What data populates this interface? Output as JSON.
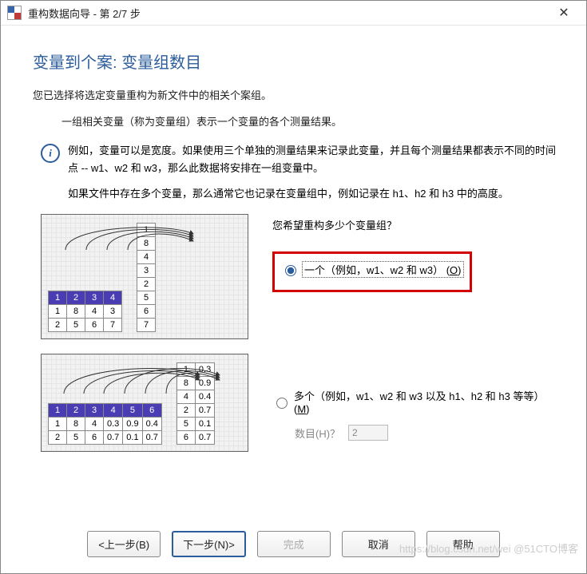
{
  "window": {
    "title": "重构数据向导 - 第 2/7 步"
  },
  "page_title": "变量到个案: 变量组数目",
  "intro": "您已选择将选定变量重构为新文件中的相关个案组。",
  "sub1": "一组相关变量（称为变量组）表示一个变量的各个测量结果。",
  "info1": "例如，变量可以是宽度。如果使用三个单独的测量结果来记录此变量，并且每个测量结果都表示不同的时间点 -- w1、w2 和 w3，那么此数据将安排在一组变量中。",
  "info2": "如果文件中存在多个变量，那么通常它也记录在变量组中，例如记录在 h1、h2 和 h3 中的高度。",
  "question": "您希望重构多少个变量组？",
  "options": {
    "one": {
      "label": "一个（例如，w1、w2 和 w3）",
      "shortcut": "O"
    },
    "many": {
      "label": "多个（例如，w1、w2 和 w3 以及 h1、h2 和 h3 等等）",
      "shortcut": "M"
    },
    "count_label": "数目(H)？",
    "count_value": "2"
  },
  "illustration1": {
    "source_headers": [
      "1",
      "2",
      "3",
      "4"
    ],
    "source_rows": [
      [
        "1",
        "8",
        "4",
        "3"
      ],
      [
        "2",
        "5",
        "6",
        "7"
      ]
    ],
    "target_col": [
      "1",
      "8",
      "4",
      "3",
      "2",
      "5",
      "6",
      "7"
    ]
  },
  "illustration2": {
    "source_headers": [
      "1",
      "2",
      "3",
      "4",
      "5",
      "6"
    ],
    "source_rows": [
      [
        "1",
        "8",
        "4",
        "0.3",
        "0.9",
        "0.4"
      ],
      [
        "2",
        "5",
        "6",
        "0.7",
        "0.1",
        "0.7"
      ]
    ],
    "target_cols": [
      [
        "1",
        "8",
        "4",
        "2",
        "5",
        "6"
      ],
      [
        "0.3",
        "0.9",
        "0.4",
        "0.7",
        "0.1",
        "0.7"
      ]
    ]
  },
  "buttons": {
    "back": "<上一步(B)",
    "next": "下一步(N)>",
    "finish": "完成",
    "cancel": "取消",
    "help": "帮助"
  },
  "watermark": "https://blog.csdn.net/wei  @51CTO博客"
}
